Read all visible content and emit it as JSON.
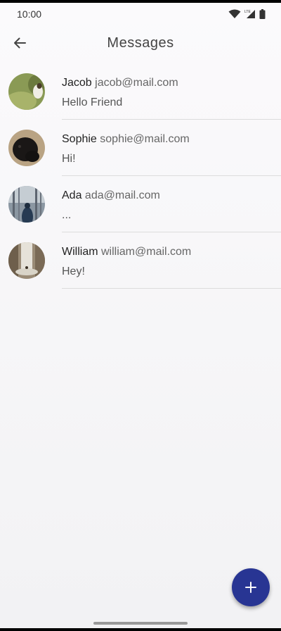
{
  "status_bar": {
    "time": "10:00",
    "network_label": "LTE"
  },
  "app_bar": {
    "title": "Messages",
    "back_icon": "arrow-left-icon"
  },
  "messages": [
    {
      "name": "Jacob",
      "email": "jacob@mail.com",
      "preview": "Hello Friend"
    },
    {
      "name": "Sophie",
      "email": "sophie@mail.com",
      "preview": "Hi!"
    },
    {
      "name": "Ada",
      "email": "ada@mail.com",
      "preview": "..."
    },
    {
      "name": "William",
      "email": "william@mail.com",
      "preview": "Hey!"
    }
  ],
  "fab": {
    "icon": "plus-icon"
  },
  "colors": {
    "accent": "#283593",
    "background": "#f7f7f9",
    "divider": "#dcdcdc"
  }
}
